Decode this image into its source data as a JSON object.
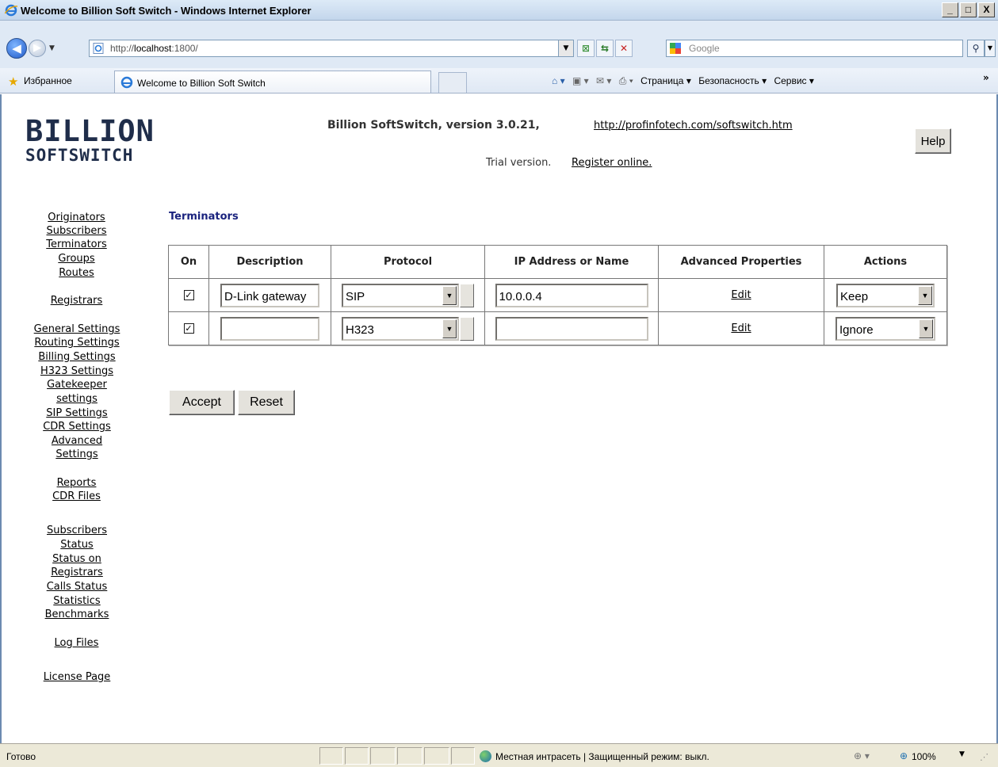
{
  "window": {
    "title": "Welcome to Billion Soft Switch - Windows Internet Explorer",
    "min": "_",
    "max": "□",
    "close": "X"
  },
  "browser": {
    "url_prefix": "http://",
    "url_host": "localhost",
    "url_rest": ":1800/",
    "search_placeholder": "Google",
    "favorites_label": "Избранное",
    "tab_title": "Welcome to Billion Soft Switch",
    "commands": [
      "Страница ▾",
      "Безопасность ▾",
      "Сервис ▾"
    ],
    "status": "Готово",
    "zone": "Местная интрасеть | Защищенный режим: выкл.",
    "zoom": "100%"
  },
  "header": {
    "logo_line1": "BILLION",
    "logo_line2": "SOFTSWITCH",
    "version": "Billion SoftSwitch, version 3.0.21,",
    "link": "http://profinfotech.com/softswitch.htm",
    "trial": "Trial version.",
    "register": "Register online.",
    "help": "Help"
  },
  "nav": {
    "originators": "Originators",
    "subscribers": "Subscribers",
    "terminators": "Terminators",
    "groups": "Groups",
    "routes": "Routes",
    "registrars": "Registrars",
    "general_settings": "General Settings",
    "routing_settings": "Routing Settings",
    "billing_settings": "Billing Settings",
    "h323_settings": "H323 Settings",
    "gatekeeper_1": "Gatekeeper",
    "gatekeeper_2": "settings",
    "sip_settings": "SIP Settings",
    "cdr_settings": "CDR Settings",
    "advanced_1": "Advanced",
    "advanced_2": "Settings",
    "reports": "Reports",
    "cdr_files": "CDR Files",
    "subscribers_status_1": "Subscribers",
    "subscribers_status_2": "Status",
    "status_registrars_1": "Status on",
    "status_registrars_2": "Registrars",
    "calls_status": "Calls Status",
    "statistics": "Statistics",
    "benchmarks": "Benchmarks",
    "log_files": "Log Files",
    "license_page": "License Page"
  },
  "main": {
    "title": "Terminators",
    "columns": [
      "On",
      "Description",
      "Protocol",
      "IP Address or Name",
      "Advanced Properties",
      "Actions"
    ],
    "rows": [
      {
        "on": "✓",
        "description": "D-Link gateway",
        "protocol": "SIP",
        "ip": "10.0.0.4",
        "advanced": "Edit",
        "action": "Keep"
      },
      {
        "on": "✓",
        "description": "",
        "protocol": "H323",
        "ip": "",
        "advanced": "Edit",
        "action": "Ignore"
      }
    ],
    "accept": "Accept",
    "reset": "Reset"
  }
}
